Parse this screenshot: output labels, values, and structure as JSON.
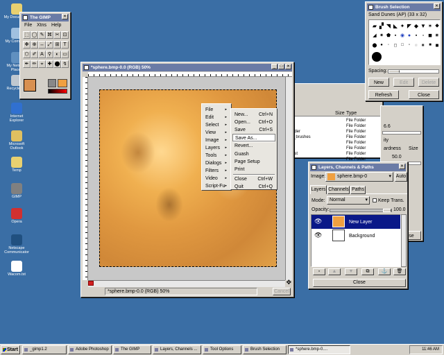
{
  "desktop": {
    "icons": [
      {
        "label": "My Documents",
        "color": "#e8d070"
      },
      {
        "label": "My Computer",
        "color": "#a0c0e0"
      },
      {
        "label": "My Network Places",
        "color": "#6090c0"
      },
      {
        "label": "Recycle Bin",
        "color": "#c0c8d0"
      },
      {
        "label": "Internet Explorer",
        "color": "#3070d0"
      },
      {
        "label": "Microsoft Outlook",
        "color": "#e0c060"
      },
      {
        "label": "Temp",
        "color": "#e8d070"
      },
      {
        "label": "GIMP",
        "color": "#808080"
      },
      {
        "label": "Opera",
        "color": "#d03030"
      },
      {
        "label": "Netscape Communicator",
        "color": "#205080"
      },
      {
        "label": "Wacom.txt",
        "color": "#ffffff"
      }
    ]
  },
  "toolbox": {
    "title": "The GIMP",
    "menu": [
      "File",
      "Xtns",
      "Help"
    ]
  },
  "image_window": {
    "title": "*sphere.bmp-0.0 (RGB) 50%",
    "status": "*sphere.bmp-0.0 (RGB) 50%",
    "cancel": "Cancel"
  },
  "image_menu": {
    "items": [
      "File",
      "Edit",
      "Select",
      "View",
      "Image",
      "Layers",
      "Tools",
      "Dialogs",
      "Filters",
      "Video",
      "Script-Fu"
    ]
  },
  "file_submenu": {
    "items": [
      {
        "label": "New...",
        "shortcut": "Ctrl+N"
      },
      {
        "label": "Open...",
        "shortcut": "Ctrl+O"
      },
      {
        "label": "Save",
        "shortcut": "Ctrl+S"
      },
      {
        "label": "Save As...",
        "shortcut": ""
      },
      {
        "label": "Revert...",
        "shortcut": ""
      },
      {
        "label": "Guash",
        "shortcut": ""
      },
      {
        "label": "Page Setup",
        "shortcut": ""
      },
      {
        "label": "Print",
        "shortcut": ""
      },
      {
        "label": "Close",
        "shortcut": "Ctrl+W"
      },
      {
        "label": "Quit",
        "shortcut": "Ctrl+Q"
      }
    ]
  },
  "brush_window": {
    "title": "Brush Selection",
    "brush_name": "Sand Dunes (AP)  (33 x 32)",
    "spacing_label": "Spacing:",
    "buttons": [
      "New",
      "Edit",
      "Delete",
      "Refresh",
      "Close"
    ]
  },
  "file_list": {
    "columns": [
      "Size",
      "Type"
    ],
    "rows": [
      {
        "name": "",
        "type": "File Folder"
      },
      {
        "name": "",
        "type": "File Folder"
      },
      {
        "name": "lder",
        "type": "File Folder"
      },
      {
        "name": "_brushes",
        "type": "File Folder"
      },
      {
        "name": "",
        "type": "File Folder"
      },
      {
        "name": "",
        "type": "File Folder"
      },
      {
        "name": "ist",
        "type": "File Folder"
      },
      {
        "name": "",
        "type": "File Folder"
      }
    ]
  },
  "tool_options": {
    "value1": "6.6",
    "label1": "ity",
    "label2": "ardness",
    "size_label": "Size",
    "value2": "50.0",
    "edge": "se"
  },
  "layers": {
    "title": "Layers, Channels & Paths",
    "image_label": "Image:",
    "image_value": "sphere.bmp-0",
    "auto": "Auto",
    "tabs": [
      "Layers",
      "Channels",
      "Paths"
    ],
    "mode_label": "Mode:",
    "mode_value": "Normal",
    "keep_trans": "Keep Trans.",
    "opacity_label": "Opacity:",
    "opacity_value": "100.0",
    "items": [
      "New Layer",
      "Background"
    ],
    "close": "Close"
  },
  "taskbar": {
    "start": "Start",
    "items": [
      "_gimp1.2",
      "Adobe Photoshop",
      "The GIMP",
      "Layers, Channels ...",
      "Tool Options",
      "Brush Selection",
      "*sphere.bmp-0...."
    ],
    "clock": "11:46 AM"
  }
}
